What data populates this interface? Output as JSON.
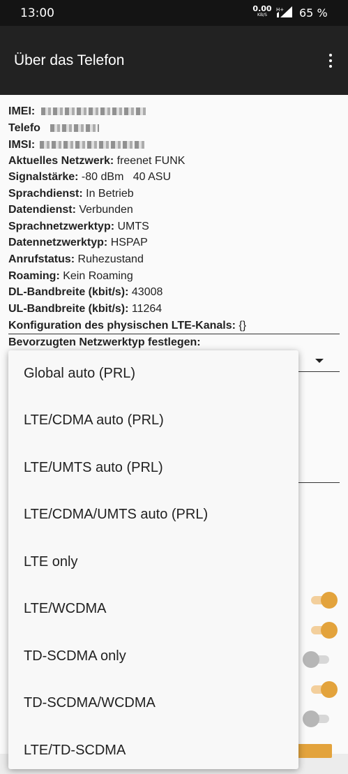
{
  "status_bar": {
    "time": "13:00",
    "net_speed": "0.00",
    "net_unit": "KB/S",
    "battery": "65 %"
  },
  "toolbar": {
    "title": "Über das Telefon",
    "menu_icon": "more-vert-icon"
  },
  "info": {
    "imei_label": "IMEI:",
    "phone_label": "Telefo",
    "imsi_label": "IMSI:",
    "network_label": "Aktuelles Netzwerk:",
    "network_value": " freenet FUNK",
    "signal_label": "Signalstärke:",
    "signal_value": " -80 dBm   40 ASU",
    "voice_label": "Sprachdienst:",
    "voice_value": " In Betrieb",
    "data_label": "Datendienst:",
    "data_value": " Verbunden",
    "voice_type_label": "Sprachnetzwerktyp:",
    "voice_type_value": " UMTS",
    "data_type_label": "Datennetzwerktyp:",
    "data_type_value": " HSPAP",
    "call_label": "Anrufstatus:",
    "call_value": " Ruhezustand",
    "roaming_label": "Roaming:",
    "roaming_value": " Kein Roaming",
    "dl_label": "DL-Bandbreite (kbit/s):",
    "dl_value": " 43008",
    "ul_label": "UL-Bandbreite (kbit/s):",
    "ul_value": " 11264",
    "lte_label": "Konfiguration des physischen LTE-Kanals:",
    "lte_value": " {}",
    "pref_label": "Bevorzugten Netzwerktyp festlegen:"
  },
  "dropdown": {
    "options": [
      "Global auto (PRL)",
      "LTE/CDMA auto (PRL)",
      "LTE/UMTS auto (PRL)",
      "LTE/CDMA/UMTS auto (PRL)",
      "LTE only",
      "LTE/WCDMA",
      "TD-SCDMA only",
      "TD-SCDMA/WCDMA",
      "LTE/TD-SCDMA"
    ]
  },
  "toggles": {
    "states": [
      "on",
      "on",
      "off",
      "on",
      "off"
    ]
  },
  "colors": {
    "accent": "#e3a33c",
    "toolbar": "#222222",
    "status_bar": "#141414"
  }
}
